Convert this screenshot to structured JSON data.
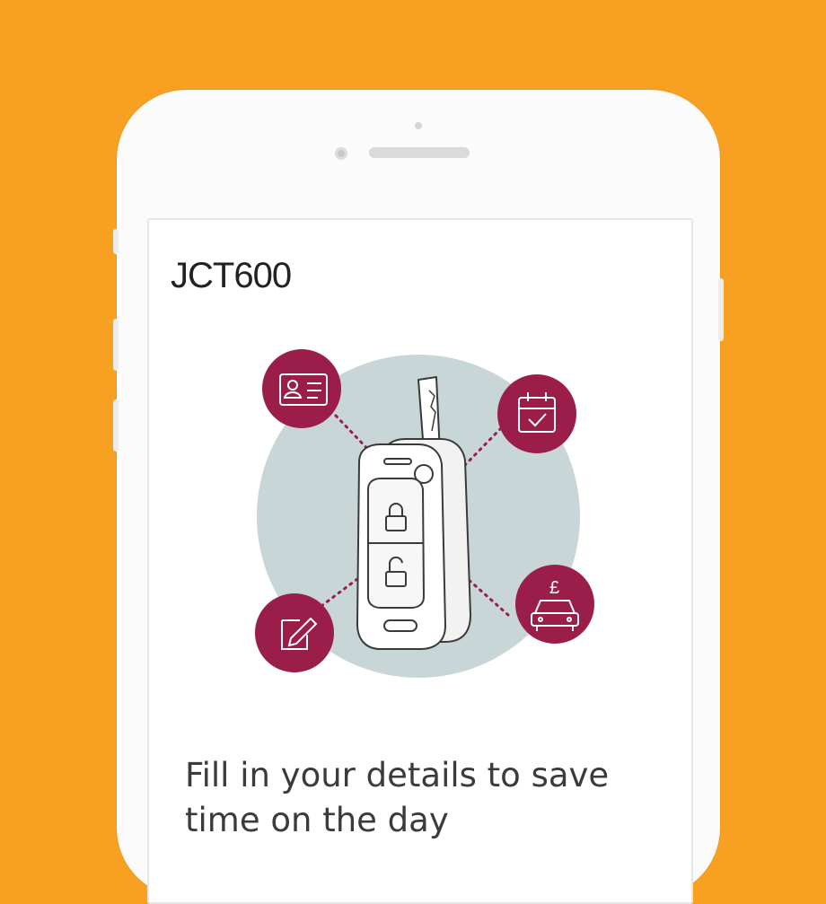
{
  "brand": {
    "logo_text": "JCT600"
  },
  "onboarding": {
    "headline": "Fill in your details to save time on the day"
  },
  "illustration": {
    "badge_icons": [
      "id-card-icon",
      "calendar-check-icon",
      "edit-document-icon",
      "pound-car-icon"
    ],
    "colors": {
      "background": "#F7A021",
      "badge": "#9B1D4A",
      "disc": "#C9D6D8",
      "key_outline": "#3A3A3A"
    }
  }
}
